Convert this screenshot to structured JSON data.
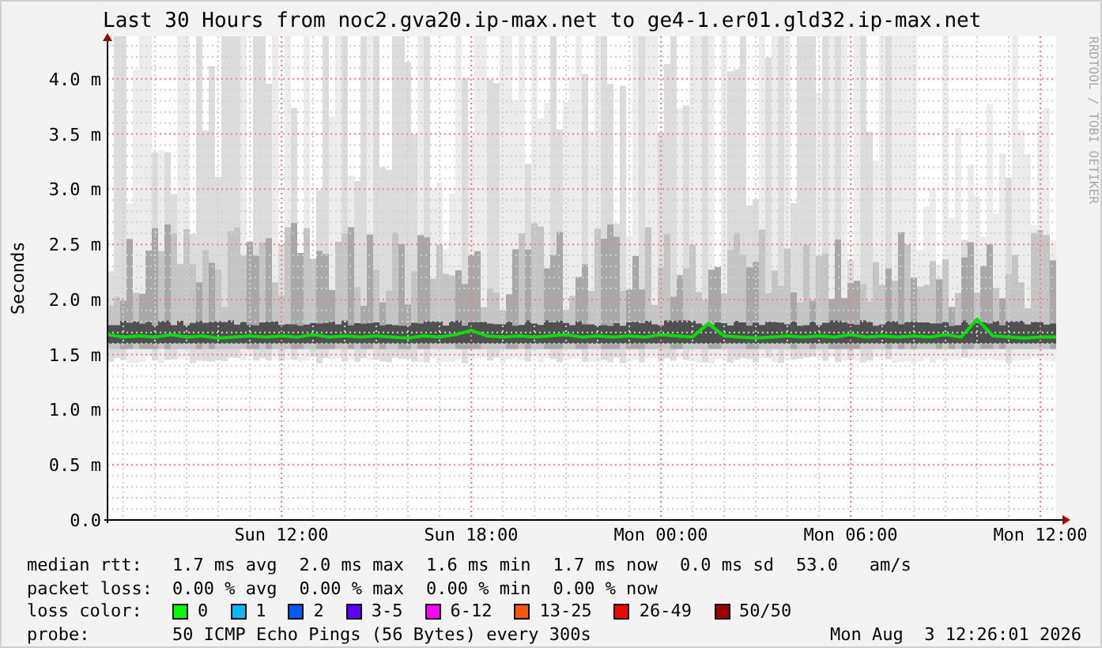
{
  "title": "Last 30 Hours from noc2.gva20.ip-max.net to ge4-1.er01.gld32.ip-max.net",
  "credit": "RRDTOOL / TOBI OETIKER",
  "chart_data": {
    "type": "line",
    "ylabel": "Seconds",
    "grid": true,
    "ylim": [
      0,
      4.4
    ],
    "categories": [
      null,
      null,
      null,
      null,
      null,
      null,
      null,
      null,
      null,
      null,
      null,
      "Sun 12:00",
      null,
      null,
      null,
      null,
      null,
      null,
      null,
      null,
      null,
      null,
      null,
      "Sun 18:00",
      null,
      null,
      null,
      null,
      null,
      null,
      null,
      null,
      null,
      null,
      null,
      "Mon 00:00",
      null,
      null,
      null,
      null,
      null,
      null,
      null,
      null,
      null,
      null,
      null,
      "Mon 06:00",
      null,
      null,
      null,
      null,
      null,
      null,
      null,
      null,
      null,
      null,
      null,
      "Mon 12:00",
      null
    ],
    "yticks": [
      {
        "value": 0,
        "label": "0.0"
      },
      {
        "value": 0.5,
        "label": "0.5 m"
      },
      {
        "value": 1,
        "label": "1.0 m"
      },
      {
        "value": 1.5,
        "label": "1.5 m"
      },
      {
        "value": 2,
        "label": "2.0 m"
      },
      {
        "value": 2.5,
        "label": "2.5 m"
      },
      {
        "value": 3,
        "label": "3.0 m"
      },
      {
        "value": 3.5,
        "label": "3.5 m"
      },
      {
        "value": 4,
        "label": "4.0 m"
      }
    ],
    "series": [
      {
        "color": "#00e000",
        "values": [
          1.68,
          1.66,
          1.67,
          1.66,
          1.68,
          1.66,
          1.67,
          1.65,
          1.66,
          1.67,
          1.66,
          1.67,
          1.66,
          1.68,
          1.66,
          1.67,
          1.66,
          1.67,
          1.66,
          1.65,
          1.67,
          1.66,
          1.68,
          1.72,
          1.67,
          1.66,
          1.67,
          1.66,
          1.67,
          1.68,
          1.66,
          1.67,
          1.66,
          1.67,
          1.66,
          1.68,
          1.67,
          1.66,
          1.78,
          1.67,
          1.66,
          1.65,
          1.66,
          1.67,
          1.66,
          1.67,
          1.66,
          1.68,
          1.66,
          1.67,
          1.66,
          1.67,
          1.66,
          1.68,
          1.66,
          1.82,
          1.67,
          1.66,
          1.65,
          1.66,
          1.66
        ]
      }
    ]
  },
  "legend": [
    {
      "kind": "stats",
      "label": "median rtt:",
      "items": [
        "1.7 ms avg",
        "2.0 ms max",
        "1.6 ms min",
        "1.7 ms now",
        "0.0 ms sd",
        "53.0   am/s"
      ]
    },
    {
      "kind": "stats",
      "label": "packet loss:",
      "items": [
        "0.00 % avg",
        "0.00 % max",
        "0.00 % min",
        "0.00 % now"
      ]
    },
    {
      "kind": "colors",
      "label": "loss color:",
      "items": [
        {
          "text": "0",
          "color": "#00ff00"
        },
        {
          "text": "1",
          "color": "#00bbff"
        },
        {
          "text": "2",
          "color": "#0059ff"
        },
        {
          "text": "3-5",
          "color": "#5e00ff"
        },
        {
          "text": "6-12",
          "color": "#ff00ff"
        },
        {
          "text": "13-25",
          "color": "#ff5500"
        },
        {
          "text": "26-49",
          "color": "#ff0000"
        },
        {
          "text": "50/50",
          "color": "#a10000"
        }
      ]
    },
    {
      "kind": "probe",
      "label": "probe:",
      "items": [
        "50 ICMP Echo Pings (56 Bytes) every 300s"
      ],
      "timestamp": "Mon Aug  3 12:26:01 2026"
    }
  ]
}
